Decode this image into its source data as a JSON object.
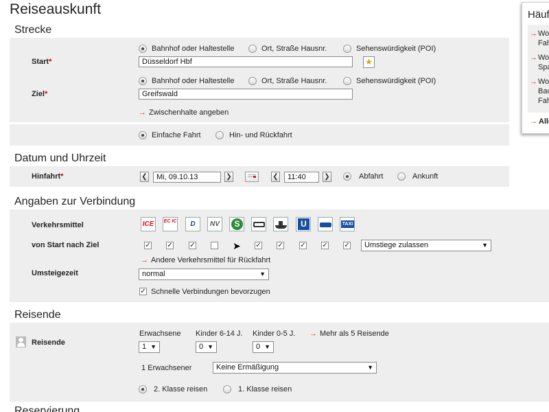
{
  "page": {
    "title": "Reiseauskunft"
  },
  "sections": {
    "strecke": "Strecke",
    "datum": "Datum und Uhrzeit",
    "angaben": "Angaben zur Verbindung",
    "reisende": "Reisende",
    "reservierung": "Reservierung"
  },
  "start": {
    "label": "Start",
    "required_mark": "*",
    "options": [
      "Bahnhof oder Haltestelle",
      "Ort, Straße Hausnr.",
      "Sehenswürdigkeit (POI)"
    ],
    "value": "Düsseldorf Hbf"
  },
  "ziel": {
    "label": "Ziel",
    "required_mark": "*",
    "options": [
      "Bahnhof oder Haltestelle",
      "Ort, Straße Hausnr.",
      "Sehenswürdigkeit (POI)"
    ],
    "value": "Greifswald"
  },
  "zwischenhalte": "Zwischenhalte angeben",
  "fahrt": {
    "einfach": "Einfache Fahrt",
    "hinrueck": "Hin- und Rückfahrt"
  },
  "hinfahrt": {
    "label": "Hinfahrt",
    "required_mark": "*",
    "date": "Mi, 09.10.13",
    "time": "11:40",
    "abfahrt": "Abfahrt",
    "ankunft": "Ankunft"
  },
  "verbindung": {
    "verkehrsmittel_label": "Verkehrsmittel",
    "start_ziel_label": "von Start nach Ziel",
    "transport_icons": [
      "ICE",
      "EC IC",
      "D",
      "NV",
      "S",
      "bus-icon",
      "ship-icon",
      "U",
      "tram-icon",
      "TAXI"
    ],
    "checked": [
      true,
      true,
      true,
      false,
      true,
      true,
      true,
      true,
      true,
      true
    ],
    "umstiege": "Umstiege zulassen",
    "andere": "Andere Verkehrsmittel für Rückfahrt",
    "umsteigezeit_label": "Umsteigezeit",
    "umsteigezeit": "normal",
    "schnelle": "Schnelle Verbindungen bevorzugen"
  },
  "reisende": {
    "label": "Reisende",
    "erwachsene_label": "Erwachsene",
    "kinder1_label": "Kinder 6-14 J.",
    "kinder2_label": "Kinder 0-5 J.",
    "erwachsene": "1",
    "kinder1": "0",
    "kinder2": "0",
    "mehr": "Mehr als 5 Reisende",
    "erw_text": "1 Erwachsener",
    "ermaessigung": "Keine Ermäßigung",
    "klasse2": "2. Klasse reisen",
    "klasse1": "1. Klasse reisen"
  },
  "sidebar": {
    "title": "Häuf",
    "items": [
      "Wo",
      "Fah",
      "Wo",
      "Spa",
      "Wo",
      "Bau",
      "Fah",
      "Alle"
    ]
  }
}
